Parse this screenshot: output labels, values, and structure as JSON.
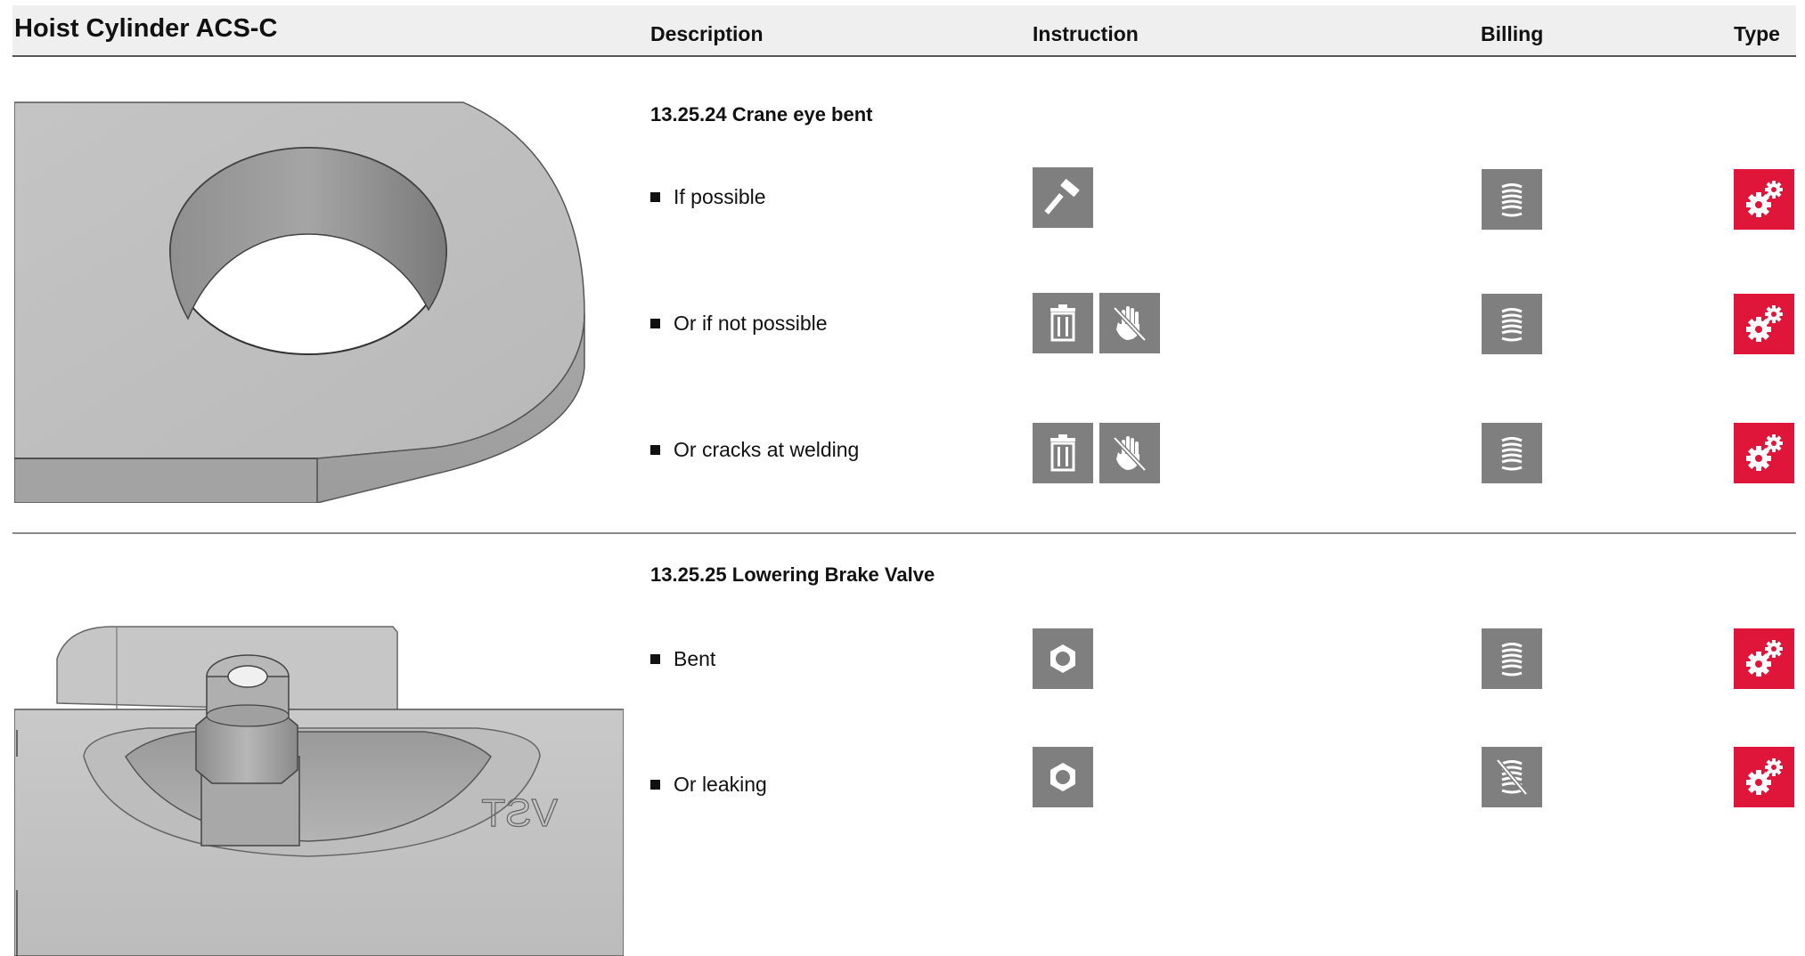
{
  "header": {
    "title": "Hoist Cylinder ACS-C",
    "columns": {
      "description": "Description",
      "instruction": "Instruction",
      "billing": "Billing",
      "type": "Type"
    }
  },
  "sections": [
    {
      "title": "13.25.24 Crane eye bent",
      "rows": [
        {
          "description": "If possible",
          "instruction_icons": [
            "hammer-icon"
          ],
          "billing_icon": "coin-stack-icon",
          "type_icon": "gears-icon"
        },
        {
          "description": "Or if not possible",
          "instruction_icons": [
            "trash-icon",
            "no-hand-icon"
          ],
          "billing_icon": "coin-stack-icon",
          "type_icon": "gears-icon"
        },
        {
          "description": "Or cracks at welding",
          "instruction_icons": [
            "trash-icon",
            "no-hand-icon"
          ],
          "billing_icon": "coin-stack-icon",
          "type_icon": "gears-icon"
        }
      ]
    },
    {
      "title": "13.25.25 Lowering Brake Valve",
      "rows": [
        {
          "description": "Bent",
          "instruction_icons": [
            "hex-nut-icon"
          ],
          "billing_icon": "coin-stack-icon",
          "type_icon": "gears-icon"
        },
        {
          "description": "Or leaking",
          "instruction_icons": [
            "hex-nut-icon"
          ],
          "billing_icon": "no-coin-stack-icon",
          "type_icon": "gears-icon"
        }
      ]
    }
  ],
  "illustration_text": "VST",
  "colors": {
    "icon_gray": "#7f7f7f",
    "type_red": "#e0153a",
    "header_bg": "#efefef"
  }
}
